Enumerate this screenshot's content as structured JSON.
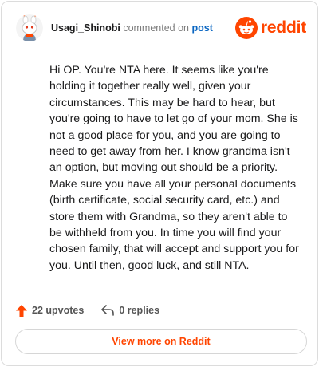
{
  "header": {
    "username": "Usagi_Shinobi",
    "verb": "commented on",
    "link": "post",
    "brand": "reddit"
  },
  "comment": {
    "text": "Hi OP. You're NTA here. It seems like you're holding it together really well, given your circumstances. This may be hard to hear, but you're going to have to let go of your mom. She is not a good place for you, and you are going to need to get away from her. I know grandma isn't an option, but moving out should be a priority. Make sure you have all your personal documents (birth certificate, social security card, etc.) and store them with Grandma, so they aren't able to be withheld from you. In time you will find your chosen family, that will accept and support you for you. Until then, good luck, and still NTA."
  },
  "actions": {
    "upvotes": "22 upvotes",
    "replies": "0 replies"
  },
  "footer": {
    "view_more": "View more on Reddit"
  },
  "colors": {
    "brand": "#ff4500",
    "link": "#0a66c2"
  },
  "icons": [
    "avatar",
    "reddit-logo-icon",
    "upvote-icon",
    "reply-icon"
  ]
}
